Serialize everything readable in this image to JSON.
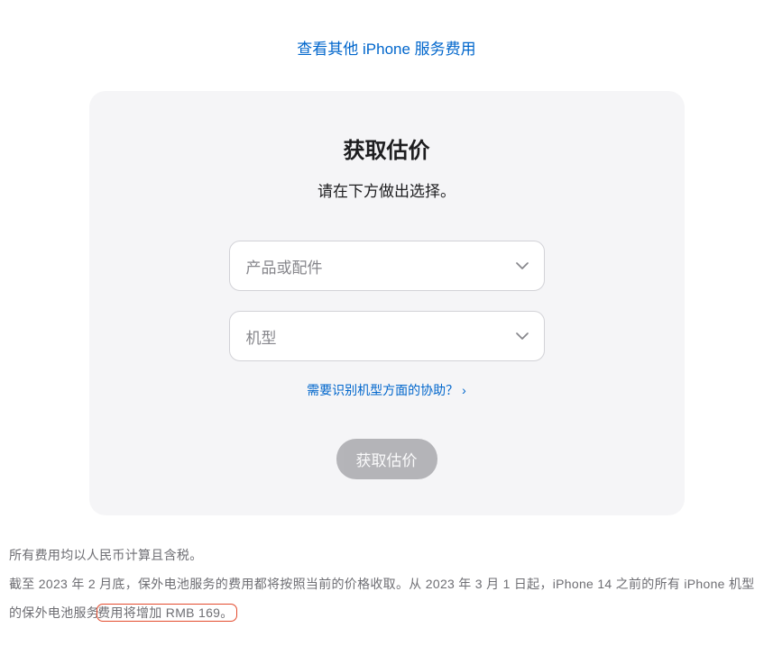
{
  "topLink": {
    "label": "查看其他 iPhone 服务费用"
  },
  "card": {
    "title": "获取估价",
    "subtitle": "请在下方做出选择。",
    "selectProduct": {
      "placeholder": "产品或配件"
    },
    "selectModel": {
      "placeholder": "机型"
    },
    "helpLink": {
      "label": "需要识别机型方面的协助？"
    },
    "submit": {
      "label": "获取估价"
    }
  },
  "footnote1": "所有费用均以人民币计算且含税。",
  "footnote2_pre": "截至 2023 年 2 月底，保外电池服务的费用都将按照当前的价格收取。从 2023 年 3 月 1 日起，iPhone 14 之前的所有 iPhone 机型的保外电池服务",
  "footnote2_hl": "费用将增加 RMB 169。"
}
